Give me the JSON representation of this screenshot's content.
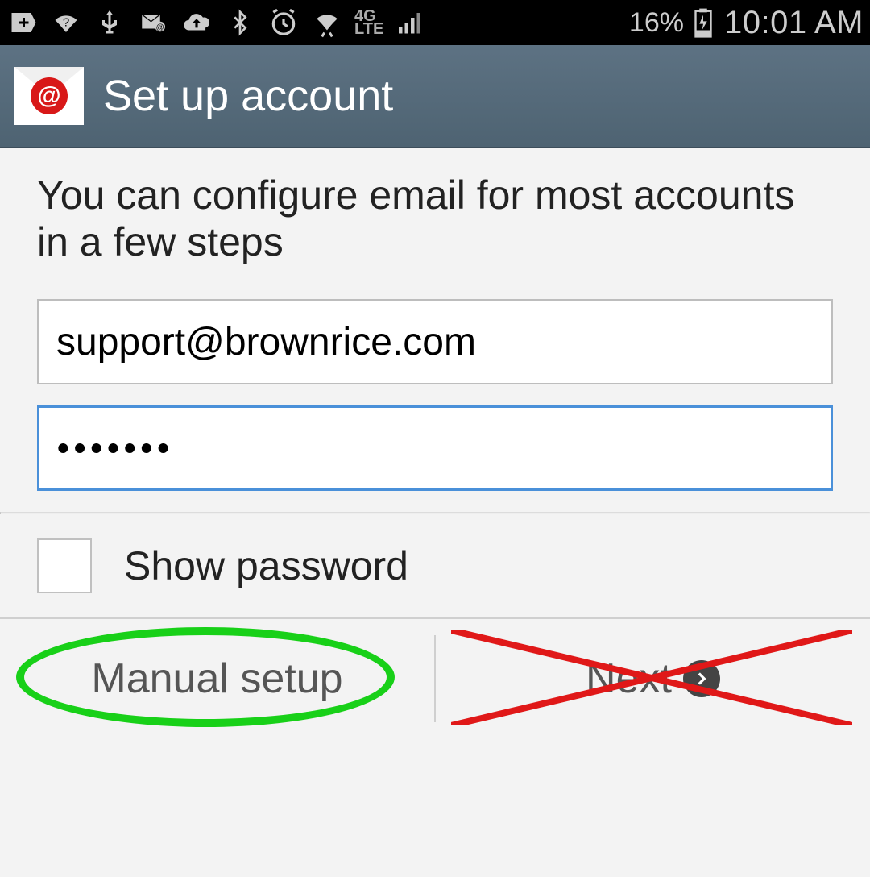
{
  "statusbar": {
    "network_label": "4G LTE",
    "battery_pct": "16%",
    "clock": "10:01 AM"
  },
  "titlebar": {
    "title": "Set up account",
    "icon_at": "@"
  },
  "content": {
    "intro": "You can configure email for most accounts in a few steps",
    "email_value": "support@brownrice.com",
    "password_value": "•••••••",
    "show_password_label": "Show password"
  },
  "bottom": {
    "manual_label": "Manual setup",
    "next_label": "Next"
  },
  "annotations": {
    "ellipse_color": "#18d018",
    "cross_color": "#e01818"
  }
}
